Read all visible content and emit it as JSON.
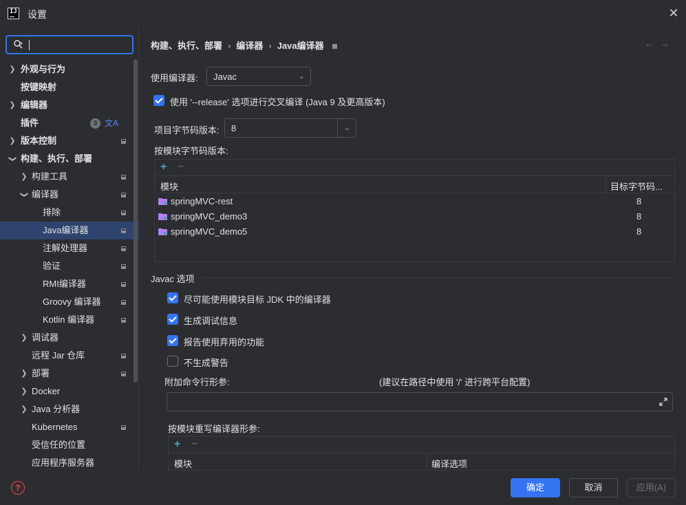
{
  "window": {
    "title": "设置",
    "logo_text": "IJ"
  },
  "search": {
    "value": ""
  },
  "sidebar": {
    "items": [
      {
        "label": "外观与行为",
        "expandable": true,
        "expanded": false,
        "bold": true
      },
      {
        "label": "按键映射",
        "expandable": false,
        "bold": true
      },
      {
        "label": "编辑器",
        "expandable": true,
        "expanded": false,
        "bold": true
      },
      {
        "label": "插件",
        "expandable": false,
        "bold": true,
        "badge": "3"
      },
      {
        "label": "版本控制",
        "expandable": true,
        "expanded": false,
        "bold": true
      },
      {
        "label": "构建、执行、部署",
        "expandable": true,
        "expanded": true,
        "bold": true
      },
      {
        "label": "构建工具",
        "expandable": true,
        "expanded": false
      },
      {
        "label": "编译器",
        "expandable": true,
        "expanded": true
      },
      {
        "label": "排除"
      },
      {
        "label": "Java编译器",
        "selected": true
      },
      {
        "label": "注解处理器"
      },
      {
        "label": "验证"
      },
      {
        "label": "RMI编译器"
      },
      {
        "label": "Groovy 编译器"
      },
      {
        "label": "Kotlin 编译器"
      },
      {
        "label": "调试器",
        "expandable": true,
        "expanded": false
      },
      {
        "label": "远程 Jar 仓库"
      },
      {
        "label": "部署",
        "expandable": true,
        "expanded": false
      },
      {
        "label": "Docker",
        "expandable": true,
        "expanded": false
      },
      {
        "label": "Java 分析器",
        "expandable": true,
        "expanded": false
      },
      {
        "label": "Kubernetes"
      },
      {
        "label": "受信任的位置"
      },
      {
        "label": "应用程序服务器"
      }
    ]
  },
  "breadcrumb": {
    "part1": "构建、执行、部署",
    "part2": "编译器",
    "part3": "Java编译器",
    "sep": "›"
  },
  "compiler": {
    "label": "使用编译器:",
    "value": "Javac"
  },
  "release_option": {
    "label": "使用 '--release' 选项进行交叉编译 (Java 9 及更高版本)",
    "checked": true
  },
  "bytecode": {
    "label": "项目字节码版本:",
    "value": "8"
  },
  "per_module": {
    "label": "按模块字节码版本:",
    "col_module": "模块",
    "col_target": "目标字节码...",
    "rows": [
      {
        "module": "springMVC-rest",
        "version": "8"
      },
      {
        "module": "springMVC_demo3",
        "version": "8"
      },
      {
        "module": "springMVC_demo5",
        "version": "8"
      }
    ]
  },
  "javac": {
    "section_title": "Javac 选项",
    "opt1": {
      "label": "尽可能使用模块目标 JDK 中的编译器",
      "checked": true
    },
    "opt2": {
      "label": "生成调试信息",
      "checked": true
    },
    "opt3": {
      "label": "报告使用弃用的功能",
      "checked": true
    },
    "opt4": {
      "label": "不生成警告",
      "checked": false
    },
    "extra_params_label": "附加命令行形参:",
    "extra_params_hint": "(建议在路径中使用 '/' 进行跨平台配置)",
    "extra_params_value": "",
    "override_label": "按模块重写编译器形参:",
    "override_col_module": "模块",
    "override_col_options": "编译选项"
  },
  "footer": {
    "help": "?",
    "ok": "确定",
    "cancel": "取消",
    "apply": "应用(A)"
  },
  "colors": {
    "accent": "#3574f0",
    "background": "#2b2d30",
    "selection": "#2e436e",
    "folder": "#b37ff0"
  }
}
